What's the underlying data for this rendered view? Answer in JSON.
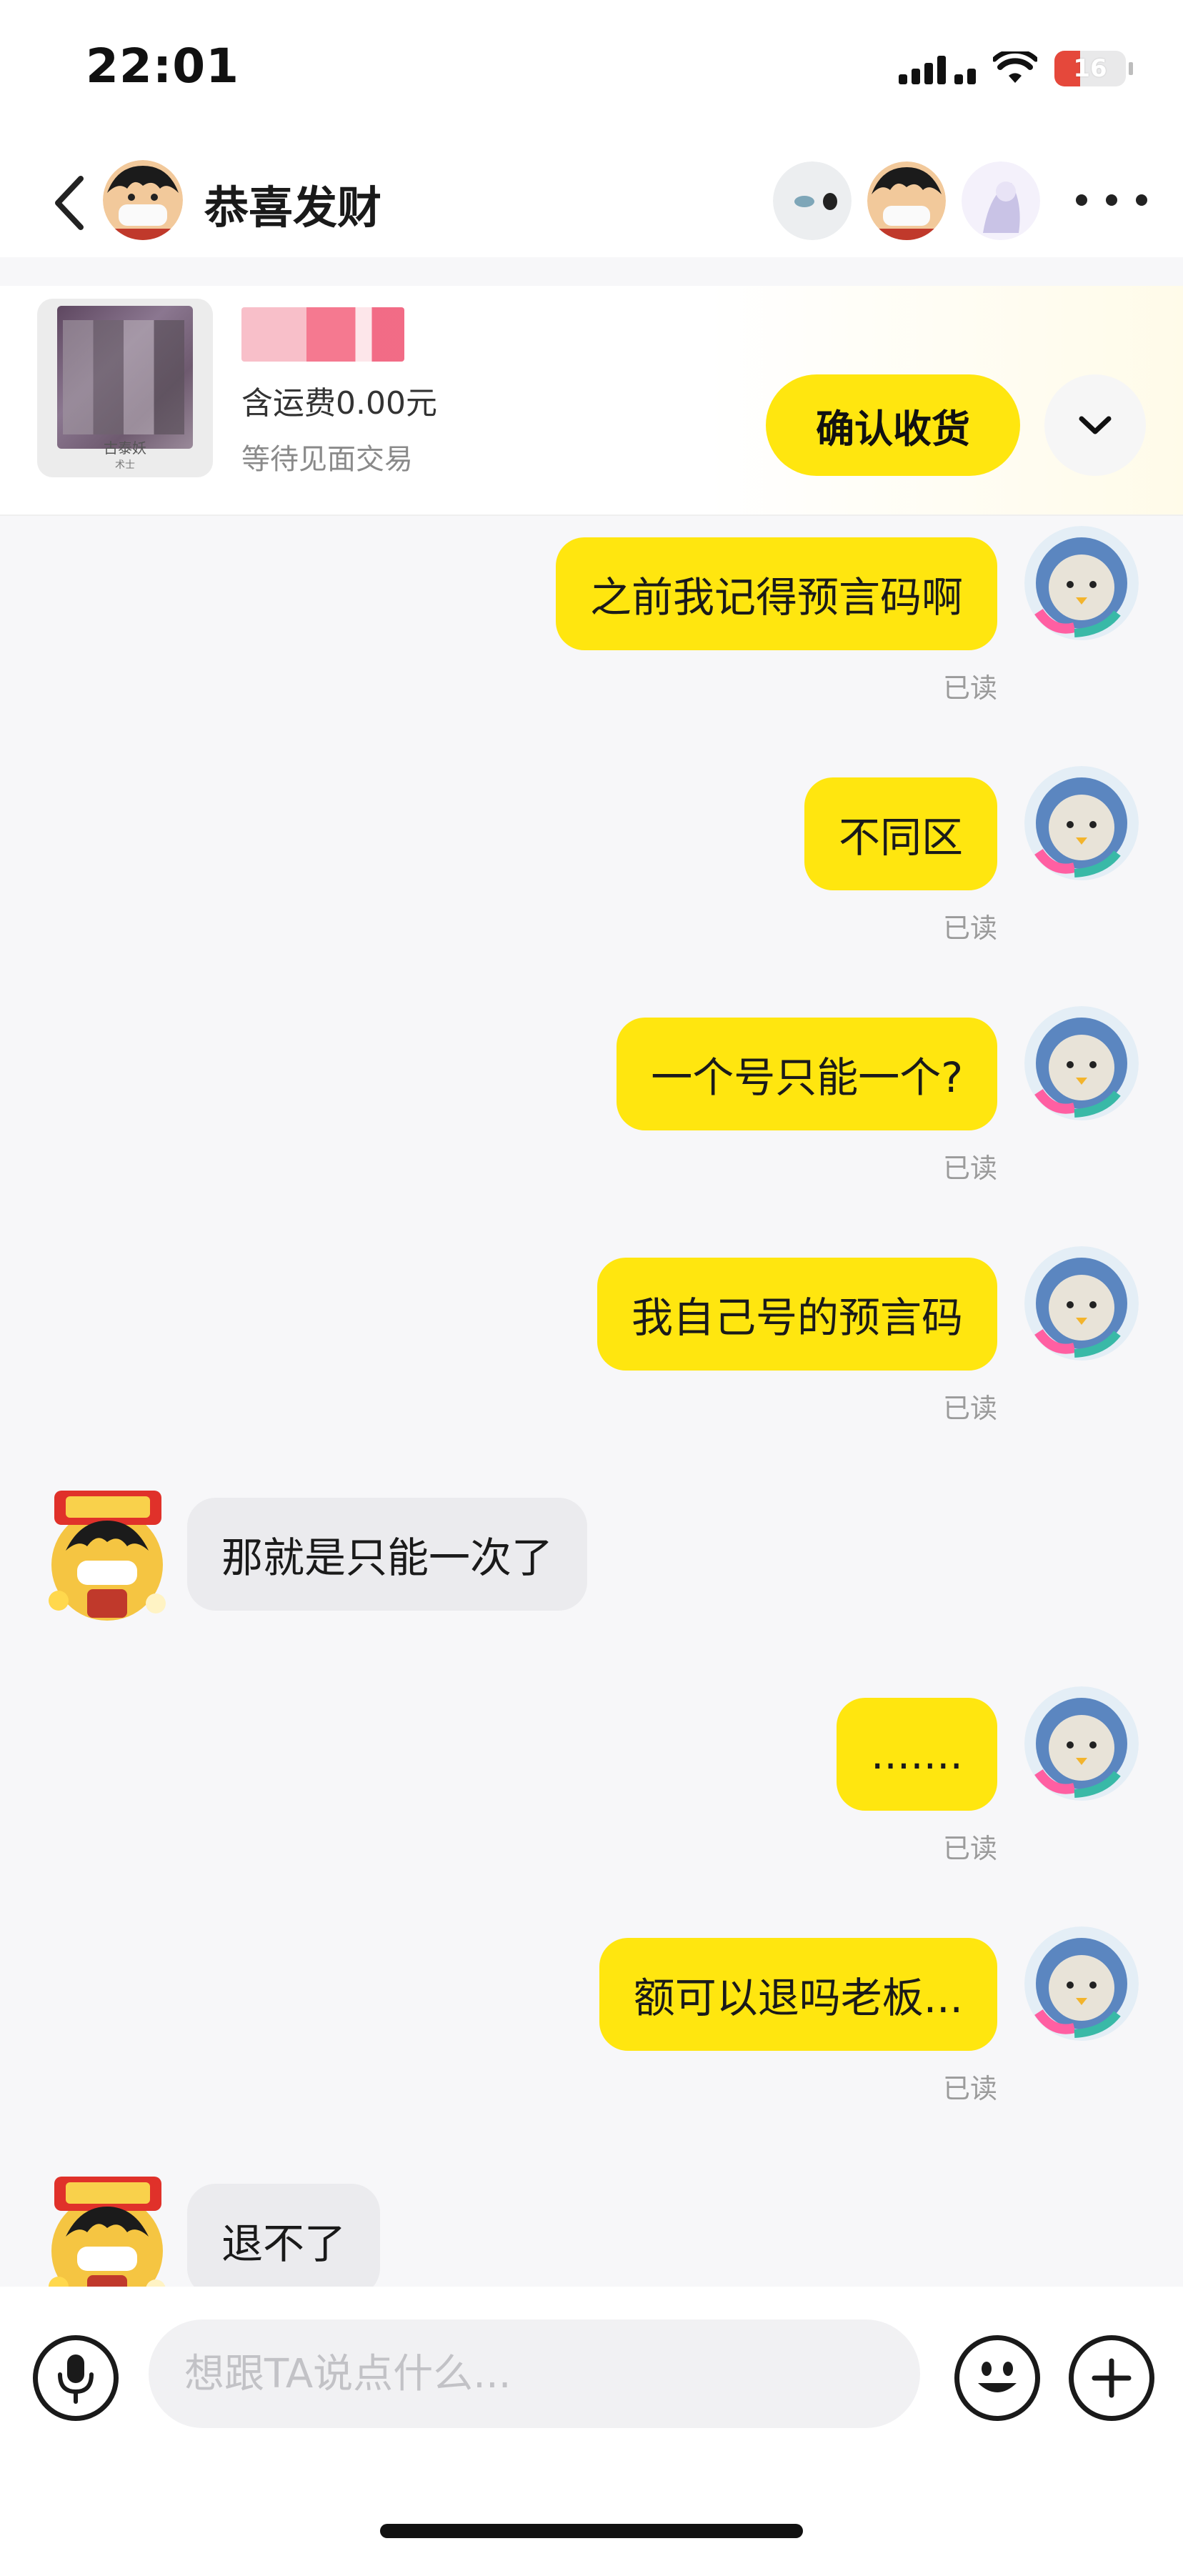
{
  "status_bar": {
    "time": "22:01",
    "battery_level": "16",
    "battery_color": "#e5483b"
  },
  "header": {
    "title": "恭喜发财",
    "back_icon": "chevron-left-icon",
    "more_icon": "more-dots-icon"
  },
  "order": {
    "thumb_caption": "古泰妖",
    "thumb_subcaption": "术士",
    "shipping": "含运费0.00元",
    "status": "等待见面交易",
    "confirm_label": "确认收货",
    "expand_icon": "chevron-down-icon"
  },
  "messages": [
    {
      "from": "me",
      "text": "之前我记得预言码啊",
      "read": "已读"
    },
    {
      "from": "me",
      "text": "不同区",
      "read": "已读"
    },
    {
      "from": "me",
      "text": "一个号只能一个?",
      "read": "已读"
    },
    {
      "from": "me",
      "text": "我自己号的预言码",
      "read": "已读"
    },
    {
      "from": "them",
      "text": "那就是只能一次了"
    },
    {
      "from": "me",
      "text": ".......",
      "read": "已读"
    },
    {
      "from": "me",
      "text": "额可以退吗老板...",
      "read": "已读"
    },
    {
      "from": "them",
      "text": "退不了"
    }
  ],
  "input": {
    "placeholder": "想跟TA说点什么..."
  },
  "colors": {
    "accent": "#ffe60f",
    "bubble_them": "#ebebee",
    "read_text": "#9b9b9b"
  }
}
